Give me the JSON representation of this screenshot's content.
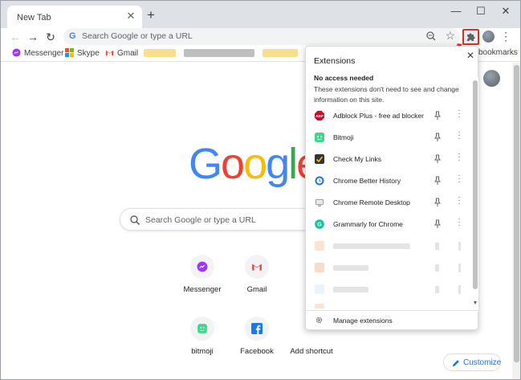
{
  "tab": {
    "title": "New Tab",
    "close_glyph": "✕",
    "new_tab_glyph": "+"
  },
  "window": {
    "minimize": "—",
    "maximize": "☐",
    "close": "✕"
  },
  "toolbar": {
    "back_glyph": "←",
    "forward_glyph": "→",
    "reload_glyph": "↻",
    "omnibox_placeholder": "Search Google or type a URL",
    "omnibox_icon": "google-g-icon",
    "star_glyph": "☆",
    "menu_glyph": "⋮"
  },
  "bookmarks": {
    "items": [
      {
        "label": "Messenger",
        "icon": "messenger-icon",
        "color": "#a033ff"
      },
      {
        "label": "Skype",
        "icon": "microsoft-icon",
        "color": "#00a4ef"
      },
      {
        "label": "Gmail",
        "icon": "gmail-icon",
        "color": "#ea4335"
      }
    ],
    "end_label": "bookmarks"
  },
  "ntp": {
    "logo_letters": [
      "G",
      "o",
      "o",
      "g",
      "l",
      "e"
    ],
    "logo_colors": [
      "#4285f4",
      "#ea4335",
      "#fbbc05",
      "#4285f4",
      "#34a853",
      "#ea4335"
    ],
    "search_placeholder": "Search Google or type a URL",
    "shortcuts": [
      {
        "label": "Messenger",
        "icon": "messenger-icon"
      },
      {
        "label": "Gmail",
        "icon": "gmail-icon"
      },
      {
        "label": "bitmoji",
        "icon": "bitmoji-icon"
      },
      {
        "label": "Facebook",
        "icon": "facebook-icon"
      },
      {
        "label": "Add shortcut",
        "icon": "add-shortcut-icon"
      }
    ],
    "customize_label": "Customize"
  },
  "extensions_popup": {
    "title": "Extensions",
    "close_glyph": "✕",
    "section_title": "No access needed",
    "section_desc": "These extensions don't need to see and change information on this site.",
    "items": [
      {
        "name": "Adblock Plus - free ad blocker",
        "icon": "adblock-plus-icon",
        "color": "#c70d2c"
      },
      {
        "name": "Bitmoji",
        "icon": "bitmoji-icon",
        "color": "#3dd68c"
      },
      {
        "name": "Check My Links",
        "icon": "check-my-links-icon",
        "color": "#333333"
      },
      {
        "name": "Chrome Better History",
        "icon": "chrome-better-history-icon",
        "color": "#1a73e8"
      },
      {
        "name": "Chrome Remote Desktop",
        "icon": "chrome-remote-desktop-icon",
        "color": "#9aa0a6"
      },
      {
        "name": "Grammarly for Chrome",
        "icon": "grammarly-icon",
        "color": "#15c39a"
      }
    ],
    "manage_label": "Manage extensions"
  }
}
